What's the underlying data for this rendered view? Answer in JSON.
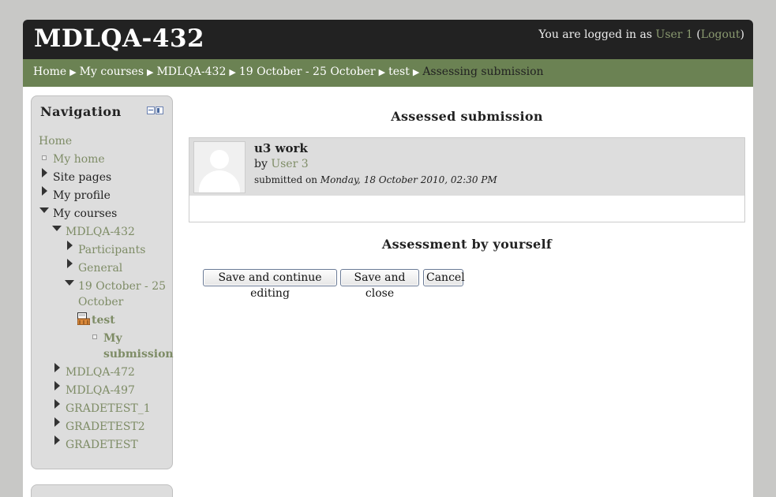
{
  "header": {
    "site_title": "MDLQA-432",
    "login_prefix": "You are logged in as ",
    "user_name": "User 1",
    "logout_label": "Logout",
    "paren_open": "(",
    "paren_close": ")"
  },
  "breadcrumb": {
    "separator": "▶",
    "items": [
      "Home",
      "My courses",
      "MDLQA-432",
      "19 October - 25 October",
      "test",
      "Assessing submission"
    ]
  },
  "navigation": {
    "title": "Navigation",
    "items": {
      "home": "Home",
      "my_home": "My home",
      "site_pages": "Site pages",
      "my_profile": "My profile",
      "my_courses": "My courses",
      "mdlqa432": "MDLQA-432",
      "participants": "Participants",
      "general": "General",
      "week_line1": "19 October - 25",
      "week_line2": "October",
      "test": "test",
      "my_sub_line1": "My",
      "my_sub_line2": "submission",
      "mdlqa472": "MDLQA-472",
      "mdlqa497": "MDLQA-497",
      "gradetest_1": "GRADETEST_1",
      "gradetest2": "GRADETEST2",
      "gradetest": "GRADETEST"
    }
  },
  "main": {
    "heading": "Assessed submission",
    "submission": {
      "title": "u3 work",
      "by_prefix": "by ",
      "author": "User 3",
      "submitted_prefix": "submitted on ",
      "submitted_date": "Monday, 18 October 2010, 02:30 PM"
    },
    "assessment_heading": "Assessment by yourself",
    "buttons": {
      "save_continue": "Save and continue editing",
      "save_close": "Save and close",
      "cancel": "Cancel"
    }
  },
  "colors": {
    "header_bg": "#222222",
    "breadcrumb_bg": "#6b8253",
    "link": "#7e8c66",
    "page_bg": "#c8c8c6"
  },
  "icons": {
    "workshop": "workshop-icon",
    "toggle": "collapse-icon"
  }
}
